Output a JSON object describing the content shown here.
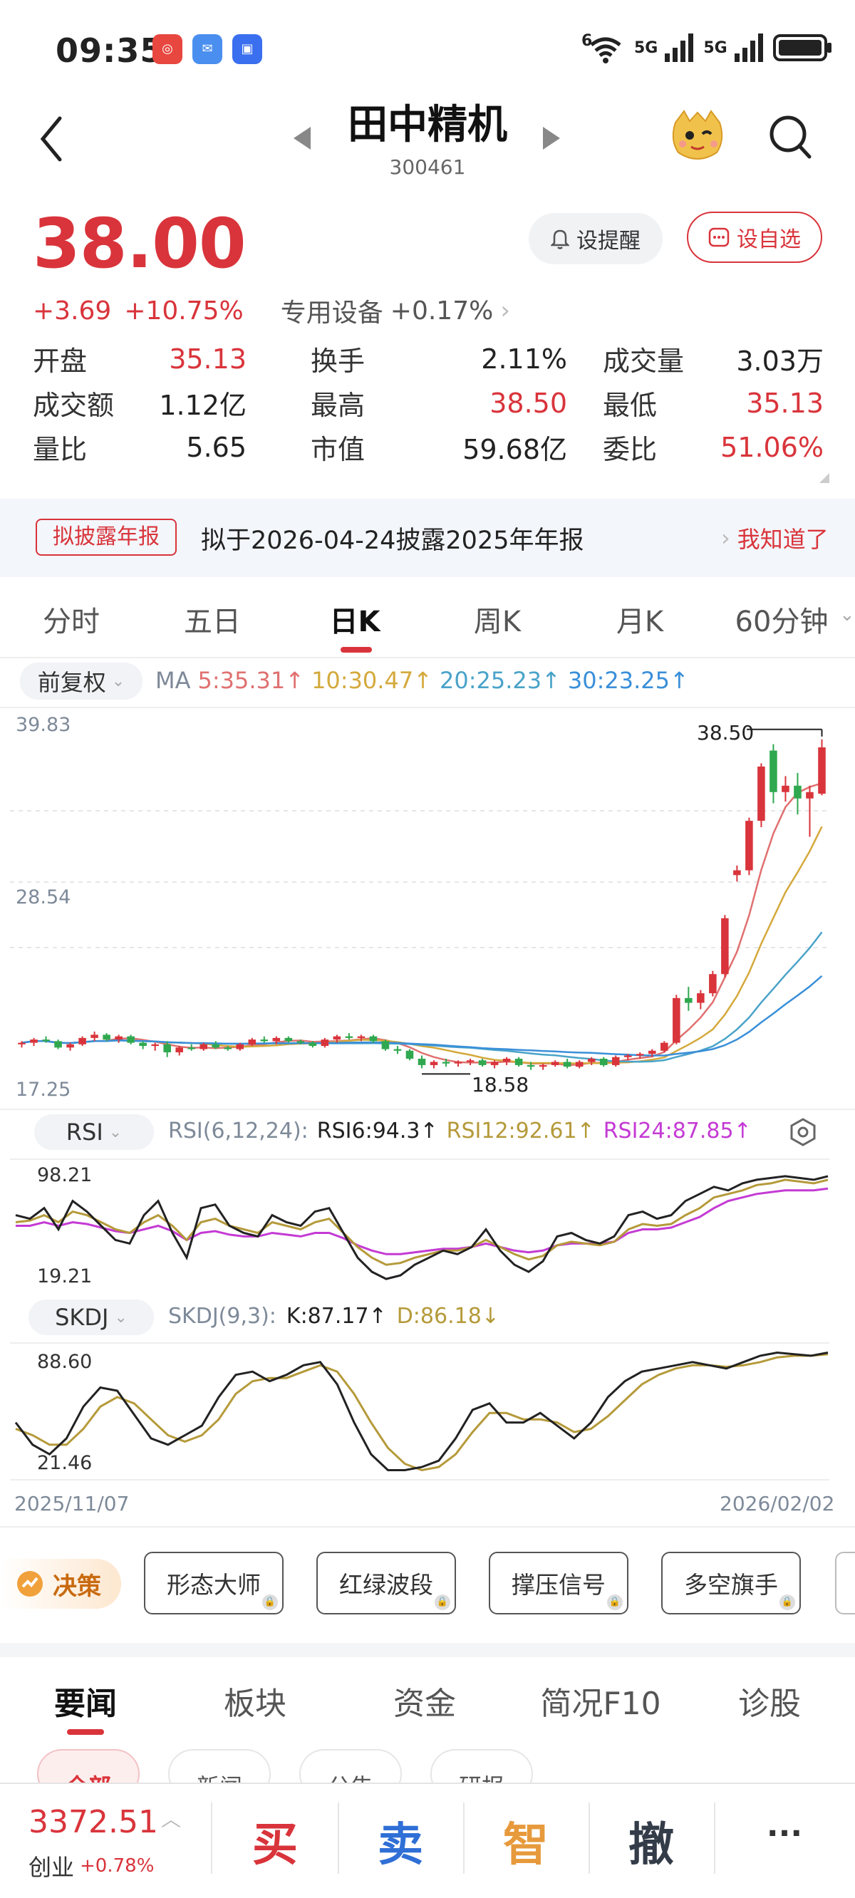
{
  "status": {
    "time": "09:35",
    "signal1": "5G",
    "signal2": "5G",
    "wifi_extra": "6"
  },
  "header": {
    "name": "田中精机",
    "code": "300461"
  },
  "quote": {
    "price": "38.00",
    "change": "+3.69",
    "change_pct": "+10.75%",
    "sector": "专用设备",
    "sector_pct": "+0.17%",
    "alert_label": "设提醒",
    "watch_label": "设自选"
  },
  "stats": [
    {
      "label": "开盘",
      "value": "35.13",
      "color": "#d9343b"
    },
    {
      "label": "换手",
      "value": "2.11%",
      "color": "#222222"
    },
    {
      "label": "成交量",
      "value": "3.03万",
      "color": "#222222"
    },
    {
      "label": "成交额",
      "value": "1.12亿",
      "color": "#222222"
    },
    {
      "label": "最高",
      "value": "38.50",
      "color": "#d9343b"
    },
    {
      "label": "最低",
      "value": "35.13",
      "color": "#d9343b"
    },
    {
      "label": "量比",
      "value": "5.65",
      "color": "#222222"
    },
    {
      "label": "市值",
      "value": "59.68亿",
      "color": "#222222"
    },
    {
      "label": "委比",
      "value": "51.06%",
      "color": "#d9343b"
    }
  ],
  "notice": {
    "tag": "拟披露年报",
    "text": "拟于2026-04-24披露2025年年报",
    "action": "我知道了"
  },
  "ktabs": [
    "分时",
    "五日",
    "日K",
    "周K",
    "月K",
    "60分钟"
  ],
  "ktab_active": "日K",
  "ma_bar": {
    "adjust": "前复权",
    "label": "MA",
    "items": [
      {
        "text": "5:35.31↑",
        "color": "#e07070"
      },
      {
        "text": "10:30.47↑",
        "color": "#d4a93c"
      },
      {
        "text": "20:25.23↑",
        "color": "#4aa3c9"
      },
      {
        "text": "30:23.25↑",
        "color": "#3a8fd9"
      }
    ]
  },
  "chart_data": {
    "type": "candlestick",
    "y_top_label": "39.83",
    "y_mid_label": "28.54",
    "y_bottom_label": "17.25",
    "high_marker": "38.50",
    "low_marker": "18.58",
    "x_start": "2025/11/07",
    "x_end": "2026/02/02",
    "ylim": [
      17.25,
      39.83
    ],
    "candles": [
      [
        19.4,
        19.6,
        19.2,
        19.5
      ],
      [
        19.5,
        19.8,
        19.3,
        19.7
      ],
      [
        19.7,
        19.9,
        19.5,
        19.6
      ],
      [
        19.6,
        19.7,
        19.1,
        19.2
      ],
      [
        19.2,
        19.5,
        19.0,
        19.4
      ],
      [
        19.4,
        19.9,
        19.3,
        19.8
      ],
      [
        19.8,
        20.2,
        19.6,
        20.0
      ],
      [
        20.0,
        20.1,
        19.6,
        19.7
      ],
      [
        19.7,
        20.0,
        19.5,
        19.9
      ],
      [
        19.9,
        20.0,
        19.4,
        19.5
      ],
      [
        19.5,
        19.6,
        19.1,
        19.3
      ],
      [
        19.3,
        19.5,
        19.0,
        19.4
      ],
      [
        19.4,
        19.6,
        18.6,
        18.9
      ],
      [
        18.9,
        19.3,
        18.7,
        19.2
      ],
      [
        19.2,
        19.4,
        19.0,
        19.1
      ],
      [
        19.1,
        19.5,
        19.0,
        19.4
      ],
      [
        19.4,
        19.6,
        19.1,
        19.2
      ],
      [
        19.2,
        19.3,
        19.0,
        19.1
      ],
      [
        19.1,
        19.5,
        19.0,
        19.4
      ],
      [
        19.4,
        19.8,
        19.3,
        19.7
      ],
      [
        19.7,
        19.9,
        19.5,
        19.6
      ],
      [
        19.6,
        19.9,
        19.4,
        19.8
      ],
      [
        19.8,
        19.9,
        19.5,
        19.6
      ],
      [
        19.6,
        19.7,
        19.4,
        19.5
      ],
      [
        19.5,
        19.6,
        19.2,
        19.3
      ],
      [
        19.3,
        19.8,
        19.2,
        19.7
      ],
      [
        19.7,
        20.0,
        19.5,
        19.9
      ],
      [
        19.9,
        20.1,
        19.7,
        19.8
      ],
      [
        19.8,
        20.0,
        19.6,
        19.9
      ],
      [
        19.9,
        20.0,
        19.5,
        19.6
      ],
      [
        19.6,
        19.7,
        19.0,
        19.1
      ],
      [
        19.1,
        19.3,
        18.8,
        19.0
      ],
      [
        19.0,
        19.1,
        18.4,
        18.5
      ],
      [
        18.5,
        18.7,
        17.9,
        18.1
      ],
      [
        18.1,
        18.4,
        17.9,
        18.3
      ],
      [
        18.3,
        18.5,
        18.0,
        18.2
      ],
      [
        18.2,
        18.4,
        18.0,
        18.3
      ],
      [
        18.3,
        18.5,
        18.1,
        18.4
      ],
      [
        18.4,
        18.5,
        18.0,
        18.1
      ],
      [
        18.1,
        18.4,
        17.9,
        18.3
      ],
      [
        18.3,
        18.6,
        18.1,
        18.5
      ],
      [
        18.5,
        18.6,
        18.0,
        18.1
      ],
      [
        18.1,
        18.3,
        17.8,
        18.0
      ],
      [
        18.0,
        18.2,
        17.8,
        18.1
      ],
      [
        18.1,
        18.4,
        18.0,
        18.3
      ],
      [
        18.3,
        18.5,
        17.9,
        18.0
      ],
      [
        18.0,
        18.4,
        17.9,
        18.3
      ],
      [
        18.3,
        18.6,
        18.1,
        18.5
      ],
      [
        18.5,
        18.6,
        18.0,
        18.1
      ],
      [
        18.1,
        18.7,
        18.0,
        18.6
      ],
      [
        18.6,
        18.8,
        18.4,
        18.7
      ],
      [
        18.7,
        18.9,
        18.5,
        18.8
      ],
      [
        18.8,
        19.1,
        18.6,
        19.0
      ],
      [
        19.0,
        19.6,
        18.9,
        19.5
      ],
      [
        19.5,
        22.5,
        19.4,
        22.3
      ],
      [
        22.3,
        23.0,
        21.5,
        22.0
      ],
      [
        22.0,
        22.8,
        21.6,
        22.6
      ],
      [
        22.6,
        24.0,
        22.4,
        23.8
      ],
      [
        23.8,
        27.5,
        23.6,
        27.3
      ],
      [
        30.0,
        30.6,
        29.6,
        30.3
      ],
      [
        30.3,
        33.6,
        30.0,
        33.4
      ],
      [
        33.4,
        37.0,
        33.0,
        36.8
      ],
      [
        37.8,
        38.2,
        34.5,
        35.2
      ],
      [
        35.2,
        36.2,
        34.6,
        35.6
      ],
      [
        35.6,
        36.4,
        33.8,
        34.8
      ],
      [
        34.8,
        35.6,
        32.4,
        35.2
      ],
      [
        35.1,
        38.5,
        35.0,
        38.0
      ]
    ]
  },
  "rsi": {
    "toggle": "RSI",
    "params": "RSI(6,12,24):",
    "v6": "RSI6:94.3↑",
    "v12": "RSI12:92.61↑",
    "v24": "RSI24:87.85↑",
    "y_top": "98.21",
    "y_bottom": "19.21",
    "rsi6": [
      72,
      70,
      76,
      64,
      80,
      74,
      66,
      58,
      56,
      72,
      80,
      62,
      48,
      76,
      78,
      66,
      62,
      60,
      72,
      68,
      66,
      74,
      76,
      62,
      48,
      40,
      36,
      38,
      44,
      48,
      52,
      50,
      54,
      64,
      52,
      44,
      40,
      46,
      60,
      62,
      58,
      56,
      60,
      72,
      74,
      70,
      72,
      80,
      84,
      88,
      86,
      90,
      92,
      93,
      94,
      93,
      92,
      94
    ],
    "rsi12": [
      68,
      69,
      72,
      68,
      74,
      72,
      68,
      64,
      62,
      68,
      72,
      66,
      58,
      68,
      70,
      66,
      64,
      62,
      68,
      66,
      64,
      68,
      70,
      62,
      54,
      48,
      44,
      45,
      48,
      50,
      52,
      52,
      54,
      58,
      54,
      50,
      47,
      49,
      55,
      57,
      56,
      55,
      57,
      64,
      67,
      66,
      67,
      72,
      76,
      82,
      84,
      86,
      89,
      90,
      92,
      91,
      90,
      92
    ],
    "rsi24": [
      66,
      66,
      68,
      66,
      68,
      67,
      65,
      63,
      62,
      64,
      66,
      63,
      58,
      62,
      63,
      61,
      60,
      60,
      62,
      61,
      60,
      62,
      62,
      59,
      55,
      52,
      50,
      50,
      51,
      52,
      53,
      53,
      54,
      56,
      54,
      52,
      51,
      52,
      55,
      56,
      56,
      56,
      57,
      62,
      64,
      64,
      65,
      68,
      71,
      76,
      80,
      82,
      84,
      85,
      86,
      86,
      86,
      87
    ]
  },
  "skdj": {
    "toggle": "SKDJ",
    "params": "SKDJ(9,3):",
    "k": "K:87.17↑",
    "d": "D:86.18↓",
    "y_top": "88.60",
    "y_bottom": "21.46",
    "k_series": [
      50,
      36,
      30,
      40,
      60,
      72,
      70,
      55,
      40,
      36,
      42,
      48,
      66,
      80,
      82,
      76,
      80,
      86,
      88,
      74,
      50,
      30,
      20,
      20,
      22,
      26,
      40,
      58,
      62,
      50,
      50,
      56,
      48,
      40,
      50,
      66,
      76,
      82,
      84,
      86,
      88,
      86,
      84,
      88,
      92,
      94,
      93,
      92,
      94
    ],
    "d_series": [
      46,
      42,
      36,
      36,
      46,
      60,
      66,
      62,
      52,
      42,
      38,
      42,
      52,
      68,
      76,
      78,
      78,
      82,
      86,
      82,
      68,
      50,
      34,
      24,
      20,
      22,
      30,
      44,
      56,
      56,
      52,
      52,
      50,
      44,
      46,
      54,
      64,
      74,
      80,
      84,
      86,
      86,
      85,
      86,
      88,
      91,
      92,
      92,
      93
    ]
  },
  "strategy": {
    "brand": "决策",
    "items": [
      "形态大师",
      "红绿波段",
      "撑压信号",
      "多空旗手"
    ]
  },
  "news_tabs": [
    "要闻",
    "板块",
    "资金",
    "简况F10",
    "诊股"
  ],
  "news_active": "要闻",
  "news_sub": [
    "全部",
    "新闻",
    "公告",
    "研报"
  ],
  "bottom": {
    "index_value": "3372.51",
    "index_name": "创业",
    "index_pct": "+0.78%",
    "buy": "买",
    "sell": "卖",
    "smart": "智",
    "cancel": "撤",
    "more": "···"
  }
}
